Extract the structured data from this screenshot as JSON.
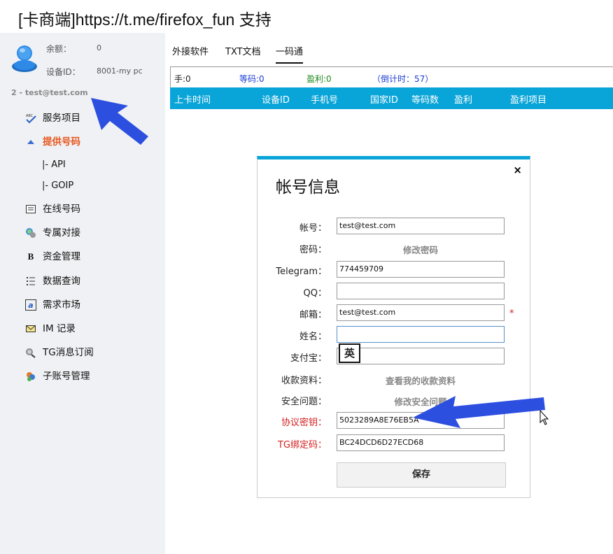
{
  "window": {
    "title_prefix": "[",
    "title_app": "卡商端",
    "title_mid": "]https://t.me/firefox_fun ",
    "title_suffix": "支持"
  },
  "account": {
    "balance_label": "余额：",
    "balance_value": "0",
    "device_label": "设备ID：",
    "device_value": "8001-my pc",
    "user_line": "2 - test@test.com"
  },
  "sidebar": {
    "items": [
      {
        "label": "服务项目",
        "icon": "abc-check-icon"
      },
      {
        "label": "提供号码",
        "icon": "arrow-up-icon"
      },
      {
        "label": "|-  API"
      },
      {
        "label": "|-  GOIP"
      },
      {
        "label": "在线号码",
        "icon": "list-icon"
      },
      {
        "label": "专属对接",
        "icon": "network-icon"
      },
      {
        "label": "资金管理",
        "icon": "bold-b-icon",
        "glyph": "B"
      },
      {
        "label": "数据查询",
        "icon": "numbered-list-icon"
      },
      {
        "label": "需求市场",
        "icon": "text-a-icon",
        "glyph": "a"
      },
      {
        "label": "IM 记录",
        "icon": "envelope-icon"
      },
      {
        "label": "TG消息订阅",
        "icon": "satellite-icon"
      },
      {
        "label": "子账号管理",
        "icon": "users-icon"
      }
    ]
  },
  "tabs": [
    {
      "label": "外接软件"
    },
    {
      "label": "TXT文档"
    },
    {
      "label": "一码通"
    }
  ],
  "stats": {
    "hand": "手:0",
    "waiting": "等码:0",
    "profit": "盈利:0",
    "countdown": "（倒计时：57）"
  },
  "table": {
    "columns": [
      "上卡时间",
      "设备ID",
      "手机号",
      "国家ID",
      "等码数",
      "盈利",
      "盈利项目"
    ]
  },
  "modal": {
    "title": "帐号信息",
    "close": "×",
    "fields": {
      "account_label": "帐号：",
      "account_value": "test@test.com",
      "password_label": "密码：",
      "password_link": "修改密码",
      "telegram_label": "Telegram：",
      "telegram_value": "774459709",
      "qq_label": "QQ：",
      "qq_value": "",
      "email_label": "邮箱：",
      "email_value": "test@test.com",
      "email_required": "*",
      "name_label": "姓名：",
      "name_value": "",
      "alipay_label": "支付宝：",
      "alipay_value": "",
      "payment_label": "收款资料：",
      "payment_link": "查看我的收款资料",
      "security_label": "安全问题：",
      "security_link": "修改安全问题",
      "protocol_key_label": "协议密钥：",
      "protocol_key_value": "5023289A8E76EB5A",
      "tg_bind_label": "TG绑定码：",
      "tg_bind_value": "BC24DCD6D27ECD68"
    },
    "ime_indicator": "英",
    "save_label": "保存"
  },
  "colors": {
    "accent_blue": "#0aa5d8",
    "active_orange": "#e8561e",
    "required_red": "#d42020",
    "stat_blue": "#1a3cd6",
    "stat_green": "#1e8a1e",
    "annotation_arrow": "#2d4fe0"
  }
}
